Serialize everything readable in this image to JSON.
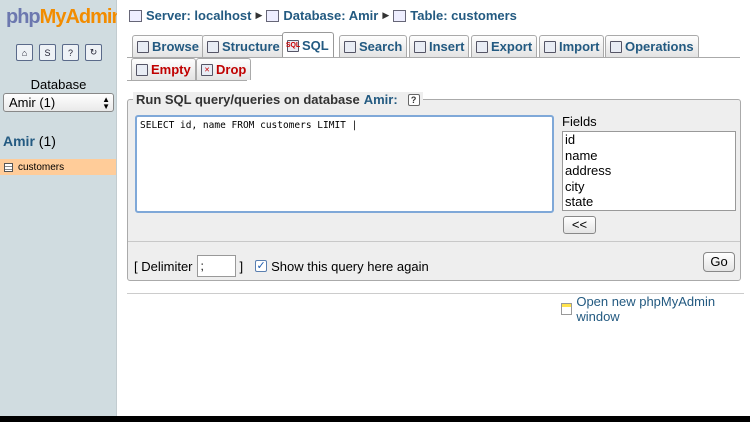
{
  "app": {
    "logo_php": "php",
    "logo_my": "My",
    "logo_admin": "Admin"
  },
  "sidebar": {
    "database_label": "Database",
    "database_select": "Amir (1)",
    "db_name": "Amir",
    "db_count": "(1)",
    "tables": [
      {
        "label": "customers"
      }
    ],
    "icons": [
      "home-icon",
      "sql-query-icon",
      "docs-icon",
      "reload-icon"
    ]
  },
  "breadcrumb": {
    "server": "Server: localhost",
    "database": "Database: Amir",
    "table": "Table: customers"
  },
  "tabs": [
    {
      "label": "Browse",
      "icon": "browse-icon"
    },
    {
      "label": "Structure",
      "icon": "structure-icon"
    },
    {
      "label": "SQL",
      "icon": "sql-icon",
      "active": true
    },
    {
      "label": "Search",
      "icon": "search-icon"
    },
    {
      "label": "Insert",
      "icon": "insert-icon"
    },
    {
      "label": "Export",
      "icon": "export-icon"
    },
    {
      "label": "Import",
      "icon": "import-icon"
    },
    {
      "label": "Operations",
      "icon": "operations-icon"
    },
    {
      "label": "Empty",
      "icon": "empty-icon",
      "danger": true
    },
    {
      "label": "Drop",
      "icon": "drop-icon",
      "danger": true
    }
  ],
  "sql": {
    "legend_prefix": "Run SQL query/queries on database",
    "legend_db": "Amir:",
    "help": "?",
    "query": "SELECT id, name FROM customers LIMIT |",
    "fields_label": "Fields",
    "fields": [
      "id",
      "name",
      "address",
      "city",
      "state"
    ],
    "insert_button": "<<",
    "delimiter_open": "[ Delimiter",
    "delimiter_value": ";",
    "delimiter_close": "]",
    "show_again_checked": true,
    "show_again_label": "Show this query here again",
    "go_button": "Go"
  },
  "footer": {
    "new_window_link": "Open new phpMyAdmin window"
  },
  "colors": {
    "link": "#235a81",
    "sidebar_bg": "#d0dce0",
    "selected_table": "#ffcc99",
    "danger": "#c00000",
    "logo_accent": "#f28c00"
  }
}
